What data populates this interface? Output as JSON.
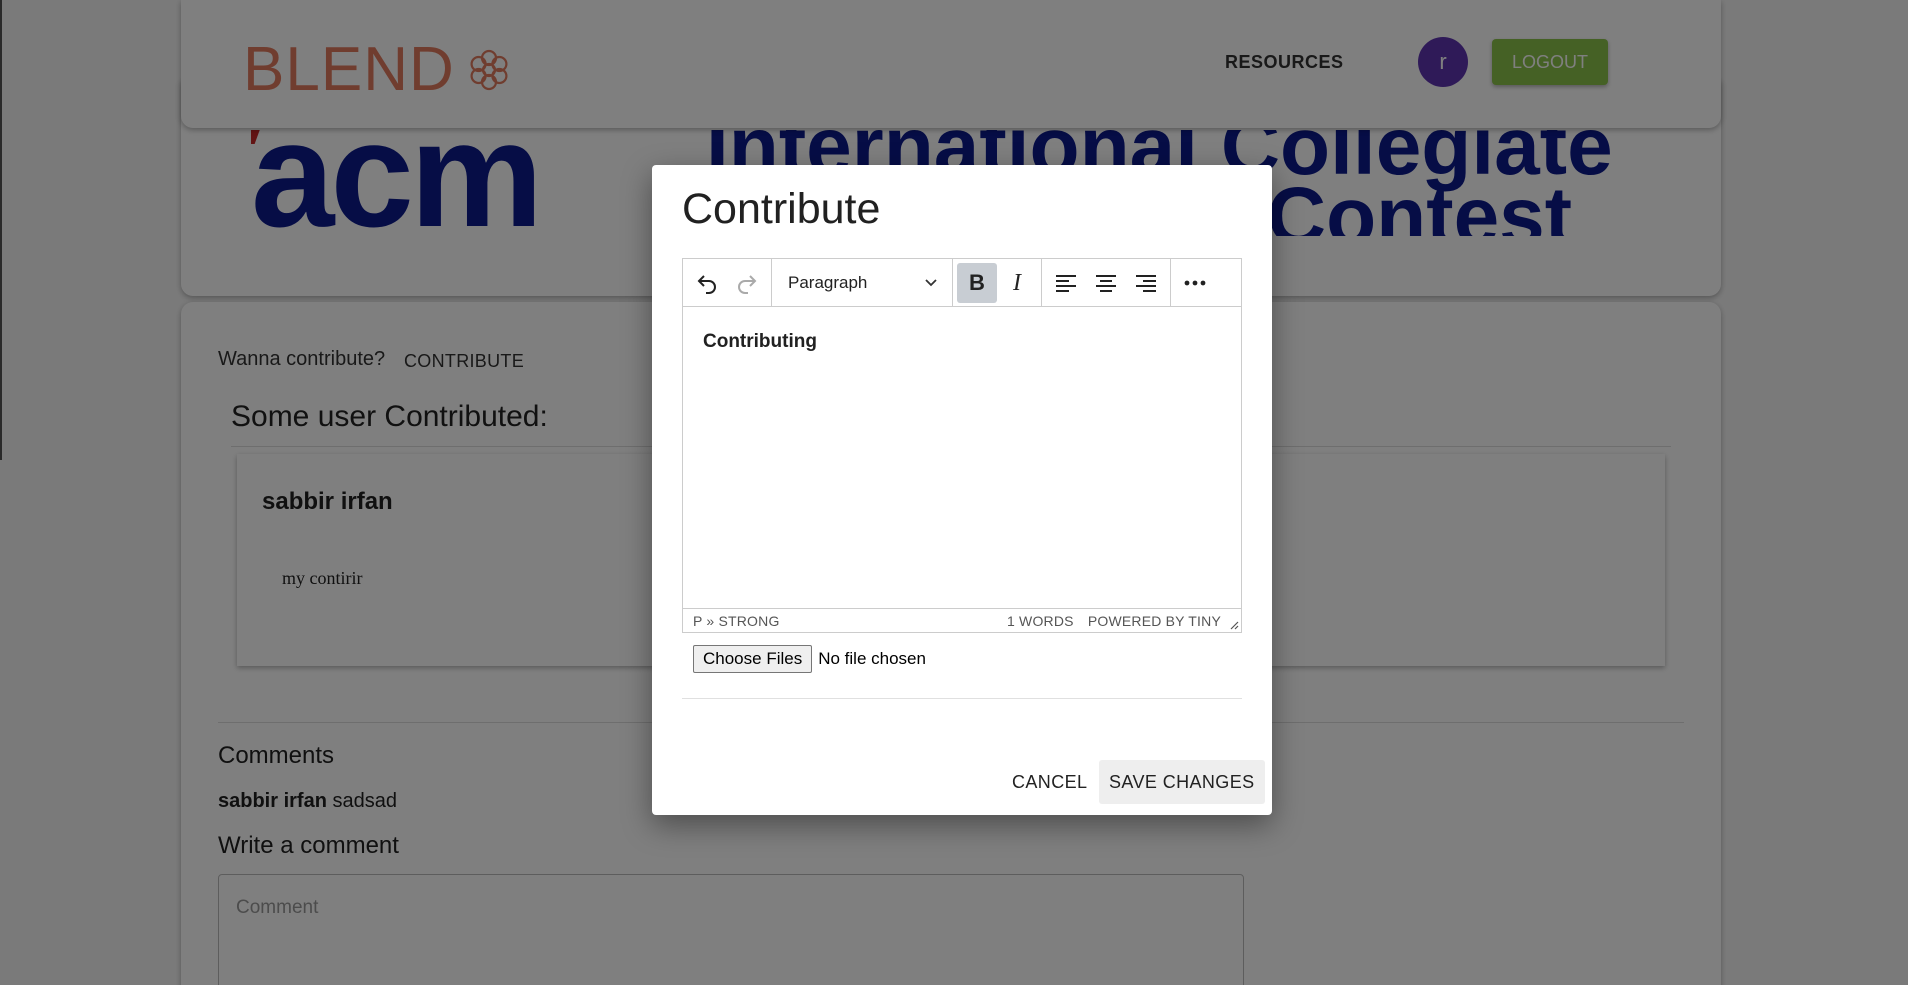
{
  "header": {
    "logo_text": "BLEND",
    "nav_resources": "RESOURCES",
    "avatar_letter": "r",
    "logout_label": "LOGOUT"
  },
  "banner": {
    "big_text": "acm",
    "line1": "International Collegiate",
    "line2": "Programming Contest"
  },
  "content": {
    "wanna_text": "Wanna contribute?",
    "contribute_link": "CONTRIBUTE",
    "contributed_heading": "Some user Contributed:",
    "post": {
      "author": "sabbir irfan",
      "body": "my contirir"
    },
    "comments_heading": "Comments",
    "comments": [
      {
        "author": "sabbir irfan",
        "text": "sadsad"
      }
    ],
    "write_heading": "Write a comment",
    "comment_placeholder": "Comment"
  },
  "dialog": {
    "title": "Contribute",
    "toolbar": {
      "block_format": "Paragraph"
    },
    "editor_content": "Contributing",
    "status_path": "P » STRONG",
    "word_count": "1 WORDS",
    "powered_by": "POWERED BY TINY",
    "file_button": "Choose Files",
    "file_status": "No file chosen",
    "cancel_label": "CANCEL",
    "save_label": "SAVE CHANGES"
  }
}
